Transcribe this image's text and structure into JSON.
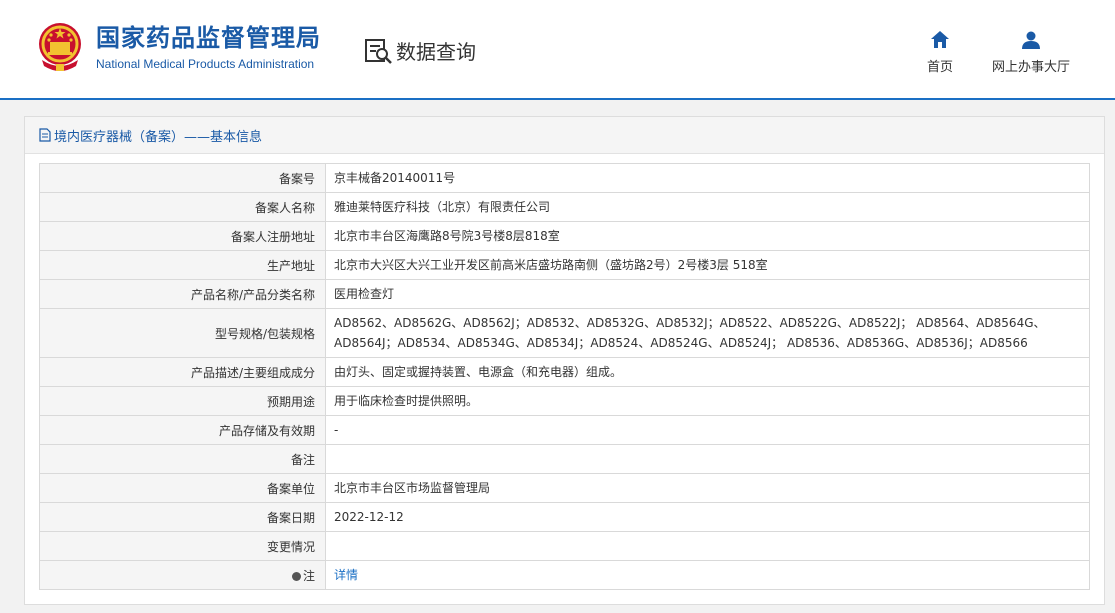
{
  "header": {
    "org_name_cn": "国家药品监督管理局",
    "org_name_en": "National Medical Products Administration",
    "query_title": "数据查询",
    "nav": [
      {
        "label": "首页",
        "icon": "home-icon"
      },
      {
        "label": "网上办事大厅",
        "icon": "user-icon"
      }
    ],
    "colors": {
      "brand_blue": "#1a5aa6",
      "accent": "#1a6fc4"
    }
  },
  "panel": {
    "title": "境内医疗器械（备案）——基本信息",
    "rows": [
      {
        "label": "备案号",
        "value": "京丰械备20140011号"
      },
      {
        "label": "备案人名称",
        "value": "雅迪莱特医疗科技（北京）有限责任公司"
      },
      {
        "label": "备案人注册地址",
        "value": "北京市丰台区海鹰路8号院3号楼8层818室"
      },
      {
        "label": "生产地址",
        "value": "北京市大兴区大兴工业开发区前高米店盛坊路南侧（盛坊路2号）2号楼3层 518室"
      },
      {
        "label": "产品名称/产品分类名称",
        "value": "医用检查灯"
      },
      {
        "label": "型号规格/包装规格",
        "value": "AD8562、AD8562G、AD8562J；AD8532、AD8532G、AD8532J；AD8522、AD8522G、AD8522J； AD8564、AD8564G、AD8564J；AD8534、AD8534G、AD8534J；AD8524、AD8524G、AD8524J； AD8536、AD8536G、AD8536J；AD8566"
      },
      {
        "label": "产品描述/主要组成成分",
        "value": "由灯头、固定或握持装置、电源盒（和充电器）组成。"
      },
      {
        "label": "预期用途",
        "value": "用于临床检查时提供照明。"
      },
      {
        "label": "产品存储及有效期",
        "value": "-"
      },
      {
        "label": "备注",
        "value": ""
      },
      {
        "label": "备案单位",
        "value": "北京市丰台区市场监督管理局"
      },
      {
        "label": "备案日期",
        "value": "2022-12-12"
      },
      {
        "label": "变更情况",
        "value": ""
      }
    ],
    "note": {
      "label": "注",
      "link": "详情"
    }
  }
}
